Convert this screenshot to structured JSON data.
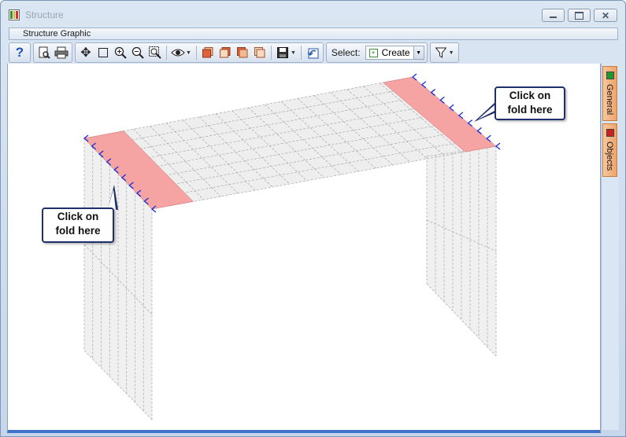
{
  "window": {
    "title": "Structure"
  },
  "menu": {
    "items": [
      "Structure Graphic"
    ]
  },
  "toolbar": {
    "select_label": "Select:",
    "select_value": "Create"
  },
  "sidepanel": {
    "tabs": [
      {
        "label": "General",
        "color": "#1d9a2a"
      },
      {
        "label": "Objects",
        "color": "#cc1f1f"
      }
    ]
  },
  "callouts": [
    {
      "line1": "Click on",
      "line2": "fold here"
    },
    {
      "line1": "Click on",
      "line2": "fold here"
    }
  ],
  "colors": {
    "fold_highlight": "#f5a3a3",
    "arrow": "#1a2bd6",
    "mesh": "#a8a8a8",
    "callout_border": "#1f2f6b",
    "accent": "#3f74c9"
  }
}
